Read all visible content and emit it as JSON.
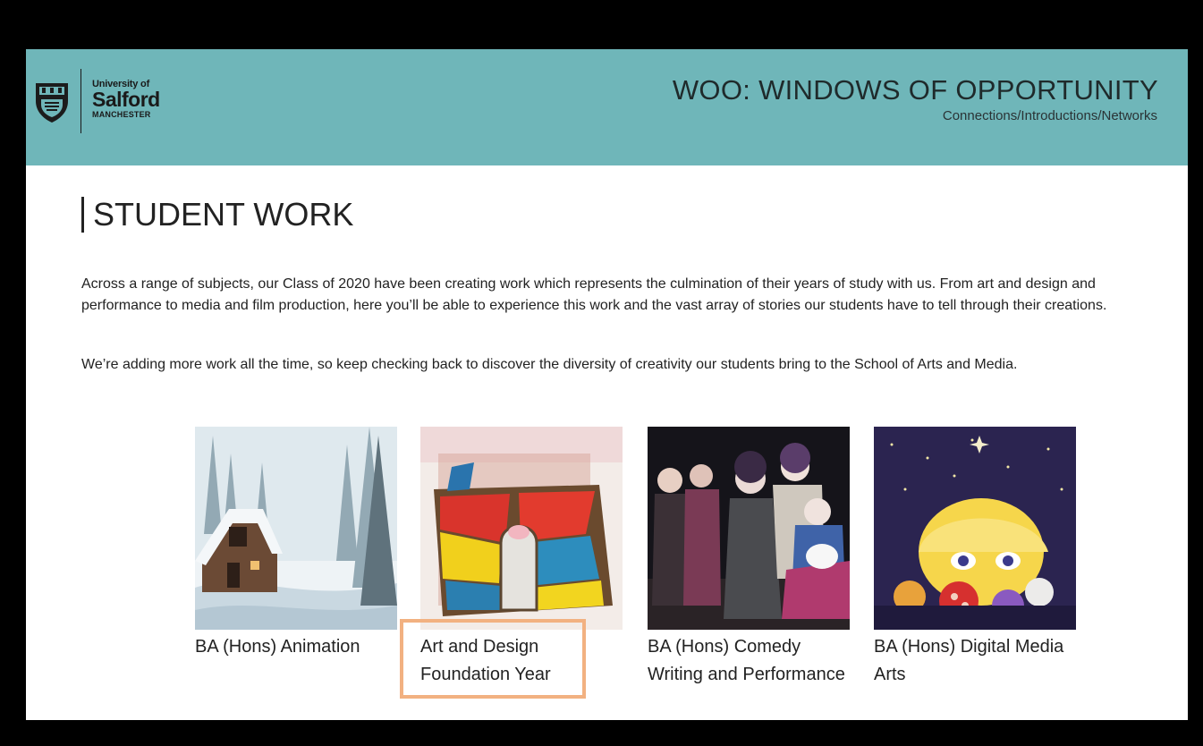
{
  "header": {
    "logo": {
      "line1": "University of",
      "line2": "Salford",
      "line3": "MANCHESTER"
    },
    "title": "WOO: WINDOWS OF OPPORTUNITY",
    "subtitle": "Connections/Introductions/Networks"
  },
  "main": {
    "heading": "STUDENT WORK",
    "paragraphs": [
      "Across a range of subjects, our Class of 2020 have been creating work which represents the culmination of their years of study with us. From art and design and performance to media and film production, here you’ll be able to experience this work and the vast array of stories our students have to tell through their creations.",
      "We’re adding more work all the time, so keep checking back to discover the diversity of creativity our students bring to the School of Arts and Media."
    ],
    "cards": [
      {
        "label": "BA (Hons) Animation",
        "image": "snowy-cabin-illustration"
      },
      {
        "label": "Art and Design Foundation Year",
        "image": "stained-glass-model"
      },
      {
        "label": "BA (Hons) Comedy Writing and Performance",
        "image": "theatre-cast-photo"
      },
      {
        "label": "BA (Hons) Digital Media Arts",
        "image": "cartoon-character-illustration"
      }
    ]
  },
  "colors": {
    "header_bg": "#6fb6b9",
    "highlight_border": "#f2b181"
  }
}
